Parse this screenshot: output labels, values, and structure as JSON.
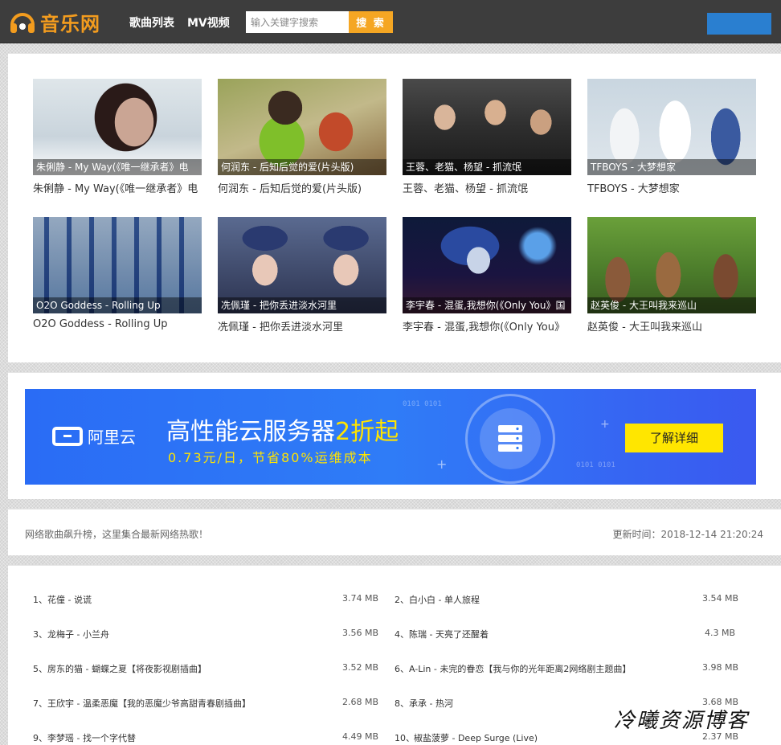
{
  "header": {
    "logo_text": "音乐网",
    "nav": [
      "歌曲列表",
      "MV视频"
    ],
    "search_placeholder": "输入关键字搜索",
    "search_button": "搜 索"
  },
  "mv_list": [
    {
      "caption": "朱俐静 - My Way(《唯一继承者》电",
      "title": "朱俐静 - My Way(《唯一继承者》电"
    },
    {
      "caption": "何润东 - 后知后觉的爱(片头版)",
      "title": "何润东 - 后知后觉的爱(片头版)"
    },
    {
      "caption": "王蓉、老猫、杨望 - 抓流氓",
      "title": "王蓉、老猫、杨望 - 抓流氓"
    },
    {
      "caption": "TFBOYS - 大梦想家",
      "title": "TFBOYS - 大梦想家"
    },
    {
      "caption": "O2O Goddess - Rolling Up",
      "title": "O2O Goddess - Rolling Up"
    },
    {
      "caption": "冼佩瑾 - 把你丢进淡水河里",
      "title": "冼佩瑾 - 把你丢进淡水河里"
    },
    {
      "caption": "李宇春 - 混蛋,我想你(《Only You》国",
      "title": "李宇春 - 混蛋,我想你(《Only You》"
    },
    {
      "caption": "赵英俊 - 大王叫我来巡山",
      "title": "赵英俊 - 大王叫我来巡山"
    }
  ],
  "ad": {
    "logo_text": "阿里云",
    "headline_main": "高性能云服务器",
    "headline_highlight": "2折起",
    "sub": "0.73元/日，节省80%运维成本",
    "cta": "了解详细",
    "bin_1": "0101 0101",
    "bin_2": "0101 0101"
  },
  "info": {
    "left": "网络歌曲飙升榜，这里集合最新网络热歌！",
    "right": "更新时间：2018-12-14 21:20:24"
  },
  "songs": [
    {
      "num": "1、",
      "name": "花僮 - 说谎",
      "size": "3.74 MB"
    },
    {
      "num": "2、",
      "name": "白小白 - 单人旅程",
      "size": "3.54 MB"
    },
    {
      "num": "3、",
      "name": "龙梅子 - 小兰舟",
      "size": "3.56 MB"
    },
    {
      "num": "4、",
      "name": "陈瑞 - 天亮了还醒着",
      "size": "4.3 MB"
    },
    {
      "num": "5、",
      "name": "房东的猫 - 蝴蝶之夏【将夜影视剧插曲】",
      "size": "3.52 MB"
    },
    {
      "num": "6、",
      "name": "A-Lin - 未完的眷恋【我与你的光年距离2网络剧主题曲】",
      "size": "3.98 MB"
    },
    {
      "num": "7、",
      "name": "王欣宇 - 温柔恶魔【我的恶魔少爷高甜青春剧插曲】",
      "size": "2.68 MB"
    },
    {
      "num": "8、",
      "name": "承承 - 热河",
      "size": "3.68 MB"
    },
    {
      "num": "9、",
      "name": "李梦瑶 - 找一个字代替",
      "size": "4.49 MB"
    },
    {
      "num": "10、",
      "name": "椒盐菠萝 - Deep Surge (Live)",
      "size": "2.37 MB"
    }
  ],
  "watermark": "冷曦资源博客"
}
